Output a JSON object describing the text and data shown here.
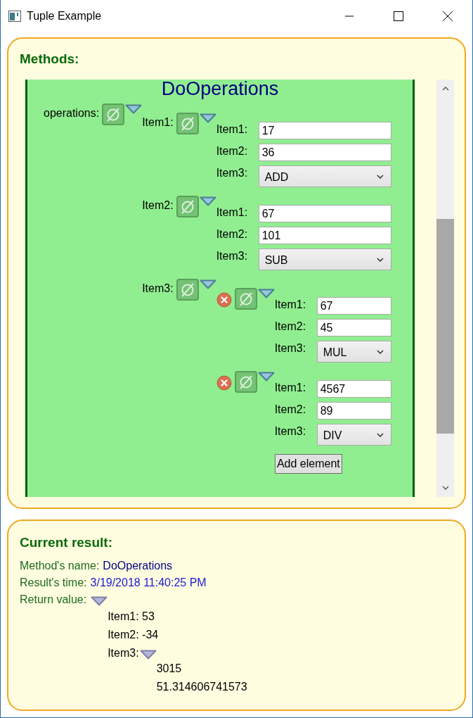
{
  "window": {
    "title": "Tuple Example"
  },
  "methods": {
    "heading": "Methods:",
    "method_name": "DoOperations",
    "parameters": [
      {
        "kind": "tuple",
        "label": "operations:",
        "items": [
          {
            "kind": "tuple",
            "label": "Item1:",
            "items": [
              {
                "kind": "field",
                "label": "Item1:",
                "value": "17"
              },
              {
                "kind": "field",
                "label": "Item2:",
                "value": "36"
              },
              {
                "kind": "choice",
                "label": "Item3:",
                "value": "ADD"
              }
            ]
          },
          {
            "kind": "tuple",
            "label": "Item2:",
            "items": [
              {
                "kind": "field",
                "label": "Item1:",
                "value": "67"
              },
              {
                "kind": "field",
                "label": "Item2:",
                "value": "101"
              },
              {
                "kind": "choice",
                "label": "Item3:",
                "value": "SUB"
              }
            ]
          },
          {
            "kind": "list",
            "label": "Item3:",
            "add_button": "Add element",
            "elements": [
              {
                "items": [
                  {
                    "kind": "field",
                    "label": "Item1:",
                    "value": "67"
                  },
                  {
                    "kind": "field",
                    "label": "Item2:",
                    "value": "45"
                  },
                  {
                    "kind": "choice",
                    "label": "Item3:",
                    "value": "MUL"
                  }
                ]
              },
              {
                "items": [
                  {
                    "kind": "field",
                    "label": "Item1:",
                    "value": "4567"
                  },
                  {
                    "kind": "field",
                    "label": "Item2:",
                    "value": "89"
                  },
                  {
                    "kind": "choice",
                    "label": "Item3:",
                    "value": "DIV"
                  }
                ]
              }
            ]
          }
        ]
      }
    ]
  },
  "result": {
    "heading": "Current result:",
    "fields": [
      {
        "kind": "name",
        "label": "Method's name:",
        "value": "DoOperations"
      },
      {
        "kind": "time",
        "label": "Result's time:",
        "value": "3/19/2018 11:40:25 PM"
      }
    ],
    "return_label": "Return value:",
    "return_items": [
      {
        "kind": "text",
        "text": "Item1: 53"
      },
      {
        "kind": "text",
        "text": "Item2: -34"
      },
      {
        "kind": "tuple",
        "label": "Item3:",
        "children": [
          "3015",
          "51.314606741573"
        ]
      }
    ]
  }
}
